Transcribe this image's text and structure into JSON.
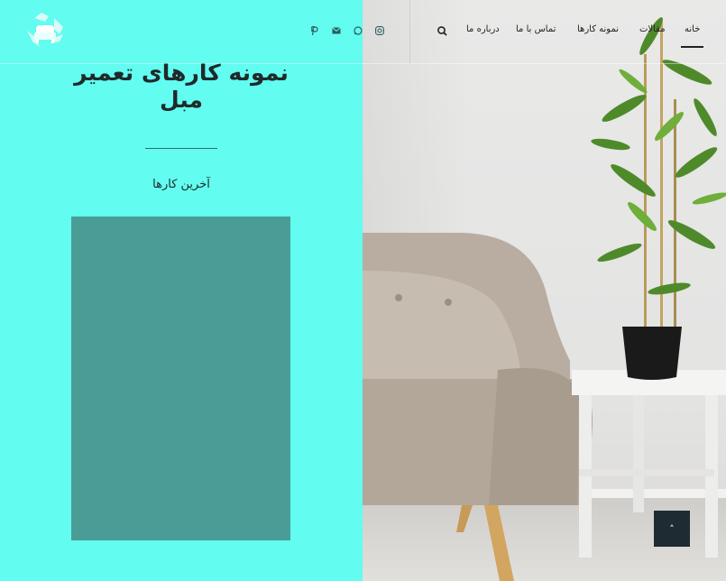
{
  "header": {
    "nav": [
      {
        "label": "خانه",
        "active": true
      },
      {
        "label": "مقالات",
        "active": false
      },
      {
        "label": "نمونه کارها",
        "active": false
      },
      {
        "label": "تماس با ما",
        "active": false
      },
      {
        "label": "درباره ما",
        "active": false
      }
    ],
    "search_icon": "search-icon",
    "social_icons": [
      "pinterest-icon",
      "mail-icon",
      "whatsapp-icon",
      "instagram-icon"
    ],
    "logo_icon": "recycle-sofa-logo"
  },
  "main": {
    "title": "نمونه کارهای تعمیر مبل",
    "subtitle": "آخرین کارها"
  },
  "colors": {
    "panel": "#62fcf0",
    "media_box": "#4a9c97",
    "to_top": "#1f2b33"
  },
  "to_top": {
    "label": "˄",
    "icon": "chevron-up-icon"
  }
}
